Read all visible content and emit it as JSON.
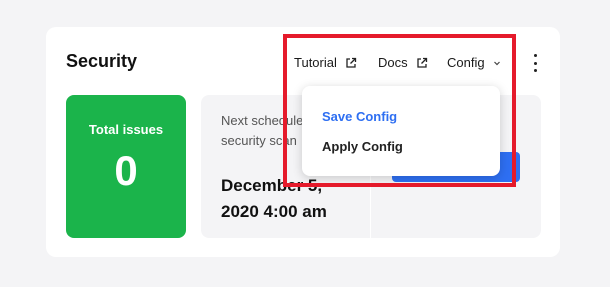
{
  "section": {
    "title": "Security"
  },
  "header": {
    "tutorial_label": "Tutorial",
    "docs_label": "Docs",
    "config_label": "Config"
  },
  "issues": {
    "label": "Total issues",
    "count": "0"
  },
  "schedule": {
    "label": "Next scheduled security scan",
    "date": "December 5, 2020 4:00 am"
  },
  "config_menu": {
    "items": [
      {
        "label": "Save Config",
        "color": "#2e6ff2"
      },
      {
        "label": "Apply Config",
        "color": "#222222"
      }
    ]
  },
  "colors": {
    "issues_tile": "#1bb44b",
    "primary_button": "#2e6ff2",
    "highlight_border": "#e51a2b"
  },
  "icons": [
    "external-link-icon",
    "chevron-down-icon",
    "more-vertical-icon"
  ]
}
